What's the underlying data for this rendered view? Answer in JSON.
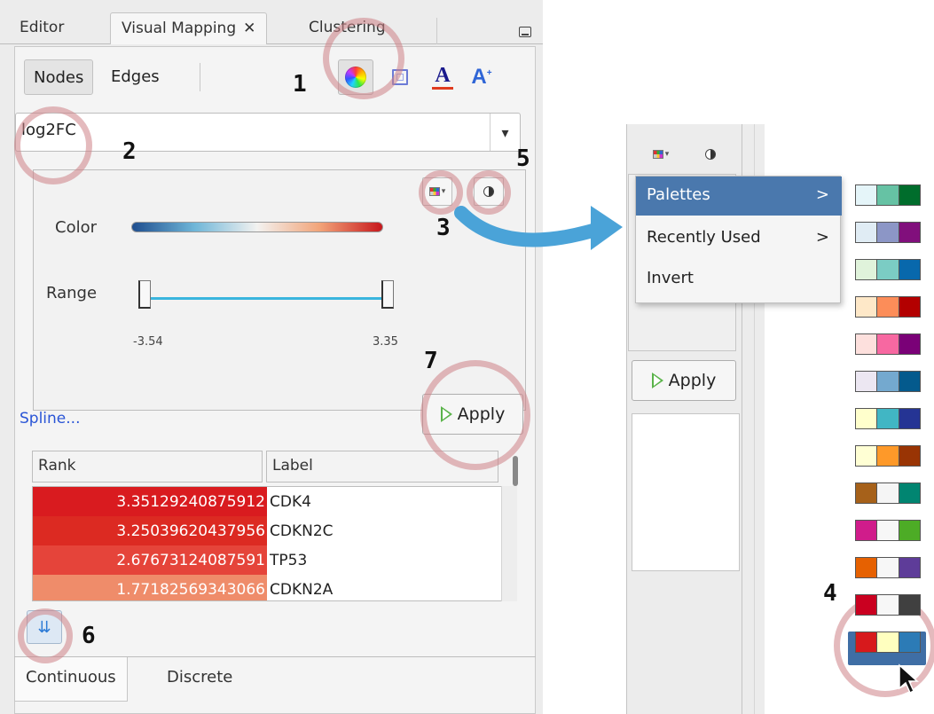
{
  "caption": "pply",
  "tabs": [
    {
      "label": "Editor"
    },
    {
      "label": "Visual Mapping"
    },
    {
      "label": "Clustering"
    }
  ],
  "subtabs": [
    "Nodes",
    "Edges"
  ],
  "attribute": "log2FC",
  "mapping": {
    "color_label": "Color",
    "range_label": "Range",
    "range_min": "-3.54",
    "range_max": "3.35"
  },
  "spline_link": "Spline...",
  "apply_label": "Apply",
  "table": {
    "headers": [
      "Rank",
      "Label"
    ],
    "rows": [
      {
        "rank": "3.35129240875912",
        "label": "CDK4",
        "color": "#d91b1f"
      },
      {
        "rank": "3.25039620437956",
        "label": "CDKN2C",
        "color": "#dc2a22"
      },
      {
        "rank": "2.67673124087591",
        "label": "TP53",
        "color": "#e5443a"
      },
      {
        "rank": "1.77182569343066",
        "label": "CDKN2A",
        "color": "#ef8c6a"
      }
    ]
  },
  "bottom_tabs": [
    "Continuous",
    "Discrete"
  ],
  "callouts": [
    "1",
    "2",
    "3",
    "4",
    "5",
    "6",
    "7"
  ],
  "menu": {
    "items": [
      {
        "label": "Palettes",
        "arrow": ">"
      },
      {
        "label": "Recently Used",
        "arrow": ">"
      },
      {
        "label": "Invert",
        "arrow": ""
      }
    ]
  },
  "palettes": [
    [
      "#e5f5f9",
      "#66c2a4",
      "#006d2c"
    ],
    [
      "#e0ecf4",
      "#8c96c6",
      "#810f7c"
    ],
    [
      "#e0f3db",
      "#7bccc4",
      "#0868ac"
    ],
    [
      "#fee8c8",
      "#fc8d59",
      "#b30000"
    ],
    [
      "#fde0dd",
      "#f768a1",
      "#7a0177"
    ],
    [
      "#ece7f2",
      "#74a9cf",
      "#045a8d"
    ],
    [
      "#ffffcc",
      "#41b6c4",
      "#253494"
    ],
    [
      "#ffffd4",
      "#fe9929",
      "#993404"
    ],
    [
      "#a6611a",
      "#f5f5f5",
      "#018571"
    ],
    [
      "#d01c8b",
      "#f7f7f7",
      "#4dac26"
    ],
    [
      "#e66101",
      "#f7f7f7",
      "#5e3c99"
    ],
    [
      "#ca0020",
      "#f7f7f7",
      "#404040"
    ],
    [
      "#d7191c",
      "#ffffbf",
      "#2c7bb6"
    ]
  ]
}
